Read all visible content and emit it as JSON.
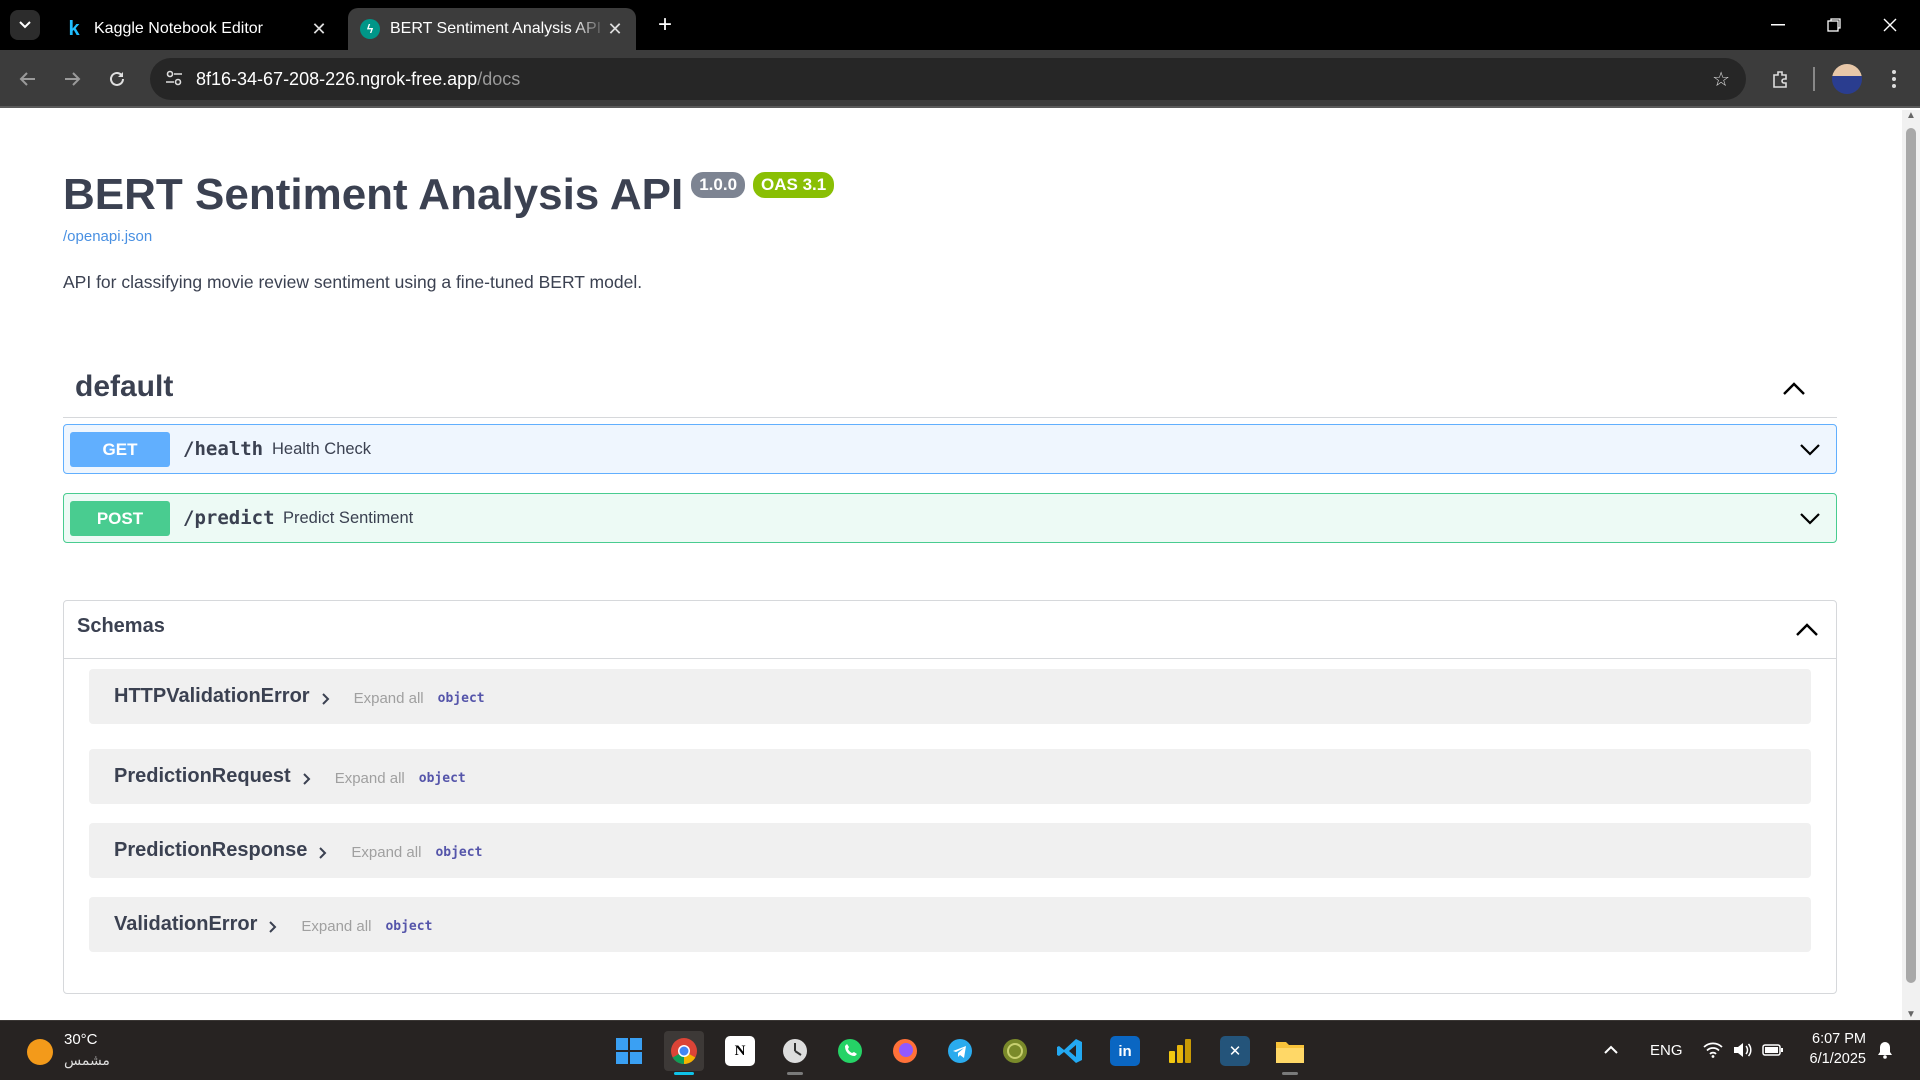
{
  "browser": {
    "tabs": [
      {
        "title": "Kaggle Notebook Editor",
        "favicon": "kaggle-icon",
        "active": false
      },
      {
        "title": "BERT Sentiment Analysis API - Swagger UI",
        "favicon": "fastapi-icon",
        "active": true
      }
    ],
    "url_host": "8f16-34-67-208-226.ngrok-free.app",
    "url_path": "/docs"
  },
  "info": {
    "title": "BERT Sentiment Analysis API",
    "version_badge": "1.0.0",
    "oas_badge": "OAS 3.1",
    "spec_link": "/openapi.json",
    "description": "API for classifying movie review sentiment using a fine-tuned BERT model."
  },
  "tag": {
    "name": "default"
  },
  "operations": [
    {
      "method": "GET",
      "path": "/health",
      "summary": "Health Check",
      "color": "#61affe"
    },
    {
      "method": "POST",
      "path": "/predict",
      "summary": "Predict Sentiment",
      "color": "#49cc90"
    }
  ],
  "schemas": {
    "title": "Schemas",
    "items": [
      {
        "name": "HTTPValidationError",
        "expand_label": "Expand all",
        "type": "object"
      },
      {
        "name": "PredictionRequest",
        "expand_label": "Expand all",
        "type": "object"
      },
      {
        "name": "PredictionResponse",
        "expand_label": "Expand all",
        "type": "object"
      },
      {
        "name": "ValidationError",
        "expand_label": "Expand all",
        "type": "object"
      }
    ]
  },
  "taskbar": {
    "weather_temp": "30°C",
    "weather_condition": "مشمس",
    "language": "ENG",
    "time": "6:07 PM",
    "date": "6/1/2025",
    "apps": [
      "start-icon",
      "chrome-icon",
      "notion-icon",
      "clock-app-icon",
      "whatsapp-icon",
      "firefox-icon",
      "telegram-icon",
      "globe-app-icon",
      "vscode-icon",
      "linkedin-icon",
      "powerbi-icon",
      "mysql-workbench-icon",
      "file-explorer-icon"
    ]
  }
}
